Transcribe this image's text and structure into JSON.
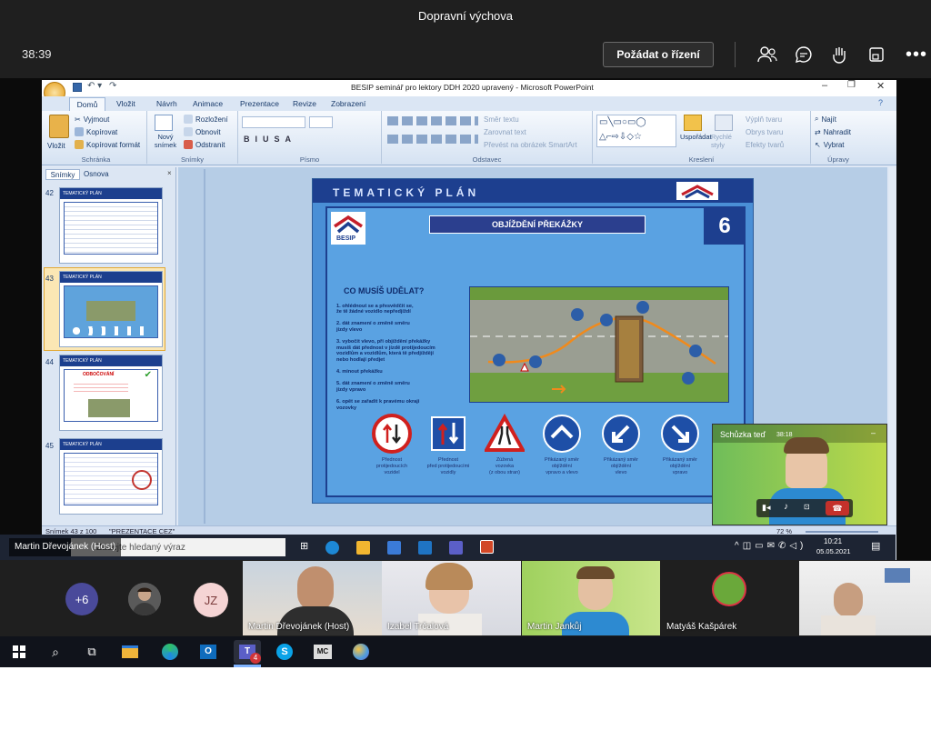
{
  "teams": {
    "meeting_title": "Dopravní výchova",
    "timer": "38:39",
    "request_control": "Požádat o řízení"
  },
  "ppt": {
    "window_title": "BESIP seminář  pro lektory DDH 2020 upravený - Microsoft PowerPoint",
    "tabs": [
      "Domů",
      "Vložit",
      "Návrh",
      "Animace",
      "Prezentace",
      "Revize",
      "Zobrazení"
    ],
    "clipboard": {
      "paste": "Vložit",
      "cut": "Vyjmout",
      "copy": "Kopírovat",
      "format": "Kopírovat formát",
      "label": "Schránka"
    },
    "slides_group": {
      "new": "Nový snímek",
      "layout": "Rozložení",
      "reset": "Obnovit",
      "delete": "Odstranit",
      "label": "Snímky"
    },
    "font_label": "Písmo",
    "paragraph": {
      "direction": "Směr textu",
      "align": "Zarovnat text",
      "smartart": "Převést na obrázek SmartArt",
      "label": "Odstavec"
    },
    "drawing": {
      "arrange": "Uspořádat",
      "quick": "Rychlé styly",
      "fill": "Výplň tvaru",
      "outline": "Obrys tvaru",
      "effects": "Efekty tvarů",
      "label": "Kreslení"
    },
    "editing": {
      "find": "Najít",
      "replace": "Nahradit",
      "select": "Vybrat",
      "label": "Úpravy"
    },
    "panel_tabs": [
      "Snímky",
      "Osnova"
    ],
    "slide_numbers": [
      "42",
      "43",
      "44",
      "45"
    ],
    "status_slide": "Snímek 43 z 100",
    "status_theme": "\"PREZENTACE CEZ\"",
    "zoom": "72 %"
  },
  "slide": {
    "header": "TEMATICKÝ  PLÁN",
    "title": "OBJÍŽDĚNÍ PŘEKÁŽKY",
    "number": "6",
    "logo_text": "BESIP",
    "question": "CO MUSÍŠ UDĚLAT?",
    "steps": [
      "1.  ohlédnout se a přesvědčit se,\n     že tě žádné vozidlo nepředjíždí",
      "2.  dát znamení o změně směru\n     jízdy vlevo",
      "3.  vybočit vlevo, při objíždění překážky\n     musíš dát přednost v jízdě protijedoucím\n     vozidlům a vozidlům, která tě předjíždějí\n     nebo hodlají předjet",
      "4.  minout překážku",
      "5.  dát znamení o změně směru\n     jízdy vpravo",
      "6.  opět se zařadit k pravému okraji\n     vozovky"
    ],
    "signs": [
      "Přednost\nprotijedoucích\nvozidel",
      "Přednost\npřed protijedoucími\nvozidly",
      "Zúžená\nvozovka\n(z obou stran)",
      "Přikázaný směr\nobjíždění\nvpravo a vlevo",
      "Přikázaný směr\nobjíždění\nvlevo",
      "Přikázaný směr\nobjíždění\nvpravo"
    ]
  },
  "thumbs": {
    "t42_title": "TEMATICKÝ PLÁN",
    "t43_title": "TEMATICKÝ PLÁN",
    "t44_title": "TEMATICKÝ PLÁN",
    "t44_sub": "ODBOČOVÁNÍ",
    "t45_title": "TEMATICKÝ PLÁN"
  },
  "remote_taskbar": {
    "presenter_label": "Martin Dřevojánek (Host)",
    "search_placeholder": "Zadejte hledaný výraz",
    "time": "10:21",
    "date": "05.05.2021"
  },
  "meet_now": {
    "title": "Schůzka teď",
    "time": "38:18"
  },
  "participants": {
    "overflow": "+6",
    "initials": "JZ",
    "tiles": [
      {
        "name": "Martin Dřevojánek (Host)"
      },
      {
        "name": "Izabel Trčalová"
      },
      {
        "name": "Martin Jankůj"
      },
      {
        "name": "Matyáš Kašpárek"
      },
      {
        "name": ""
      }
    ]
  },
  "taskbar": {
    "teams_badge": "4"
  },
  "colors": {
    "teams_dark": "#1f1f1f",
    "slide_blue": "#1f3f8f",
    "accent_red": "#cf1f1f",
    "teams_purple": "#6264a7"
  }
}
